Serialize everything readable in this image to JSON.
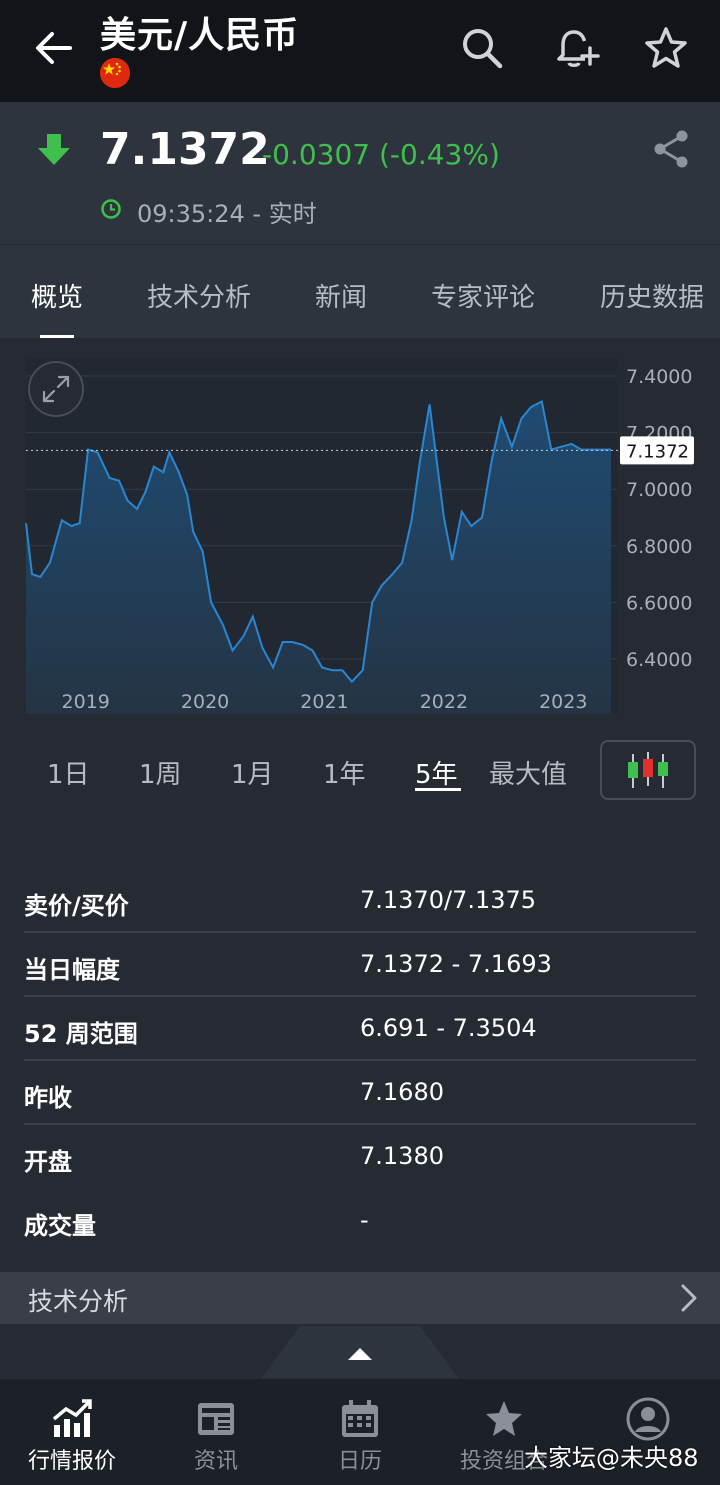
{
  "header": {
    "title": "美元/人民币",
    "flag": "china-flag"
  },
  "quote": {
    "price": "7.1372",
    "change": "-0.0307 (-0.43%)",
    "time": "09:35:24 - 实时",
    "colors": {
      "down": "#3fbf4b"
    }
  },
  "tabs": [
    {
      "label": "概览"
    },
    {
      "label": "技术分析"
    },
    {
      "label": "新闻"
    },
    {
      "label": "专家评论"
    },
    {
      "label": "历史数据"
    }
  ],
  "chart_data": {
    "type": "area",
    "current_value_label": "7.1372",
    "current_value": 7.1372,
    "y_ticks": [
      "7.4000",
      "7.2000",
      "7.0000",
      "6.8000",
      "6.6000",
      "6.4000"
    ],
    "x_ticks": [
      "2019",
      "2020",
      "2021",
      "2022",
      "2023"
    ],
    "ylim": [
      6.25,
      7.45
    ],
    "xlim": [
      2018.6,
      2023.55
    ],
    "x": [
      2018.6,
      2018.65,
      2018.72,
      2018.8,
      2018.9,
      2018.98,
      2019.05,
      2019.12,
      2019.2,
      2019.3,
      2019.38,
      2019.45,
      2019.53,
      2019.6,
      2019.67,
      2019.75,
      2019.8,
      2019.88,
      2019.95,
      2020.0,
      2020.08,
      2020.15,
      2020.25,
      2020.33,
      2020.42,
      2020.5,
      2020.58,
      2020.67,
      2020.75,
      2020.83,
      2020.92,
      2021.0,
      2021.08,
      2021.17,
      2021.25,
      2021.33,
      2021.42,
      2021.5,
      2021.58,
      2021.67,
      2021.75,
      2021.83,
      2021.9,
      2021.98,
      2022.04,
      2022.1,
      2022.17,
      2022.25,
      2022.33,
      2022.42,
      2022.5,
      2022.58,
      2022.67,
      2022.75,
      2022.83,
      2022.92,
      2023.0,
      2023.08,
      2023.17,
      2023.25,
      2023.33,
      2023.42,
      2023.5
    ],
    "values": [
      6.88,
      6.7,
      6.69,
      6.74,
      6.89,
      6.87,
      6.88,
      7.14,
      7.13,
      7.04,
      7.03,
      6.96,
      6.93,
      6.99,
      7.08,
      7.06,
      7.13,
      7.06,
      6.98,
      6.85,
      6.78,
      6.6,
      6.52,
      6.43,
      6.48,
      6.55,
      6.44,
      6.37,
      6.46,
      6.46,
      6.45,
      6.43,
      6.37,
      6.36,
      6.36,
      6.32,
      6.36,
      6.6,
      6.66,
      6.7,
      6.74,
      6.89,
      7.1,
      7.3,
      7.1,
      6.9,
      6.75,
      6.92,
      6.87,
      6.9,
      7.1,
      7.25,
      7.15,
      7.25,
      7.29,
      7.31,
      7.14,
      7.15,
      7.16,
      7.14,
      7.14,
      7.14,
      7.14
    ],
    "colors": {
      "line": "#2a86d1",
      "fill_top": "#1f4b72",
      "fill_bottom": "#243444",
      "label_bg": "#ffffff"
    }
  },
  "ranges": [
    {
      "label": "1日"
    },
    {
      "label": "1周"
    },
    {
      "label": "1月"
    },
    {
      "label": "1年"
    },
    {
      "label": "5年"
    },
    {
      "label": "最大值"
    }
  ],
  "stats": [
    {
      "key": "卖价/买价",
      "value": "7.1370/7.1375"
    },
    {
      "key": "当日幅度",
      "value": "7.1372 - 7.1693"
    },
    {
      "key": "52 周范围",
      "value": "6.691 - 7.3504"
    },
    {
      "key": "昨收",
      "value": "7.1680"
    },
    {
      "key": "开盘",
      "value": "7.1380"
    },
    {
      "key": "成交量",
      "value": "-"
    }
  ],
  "tech_section": {
    "label": "技术分析"
  },
  "bottom_nav": [
    {
      "label": "行情报价",
      "icon": "chart-up-icon"
    },
    {
      "label": "资讯",
      "icon": "newspaper-icon"
    },
    {
      "label": "日历",
      "icon": "calendar-icon"
    },
    {
      "label": "投资组合",
      "icon": "star-icon"
    },
    {
      "label": "",
      "icon": "profile-icon"
    }
  ],
  "watermark": "大家坛@未央88"
}
